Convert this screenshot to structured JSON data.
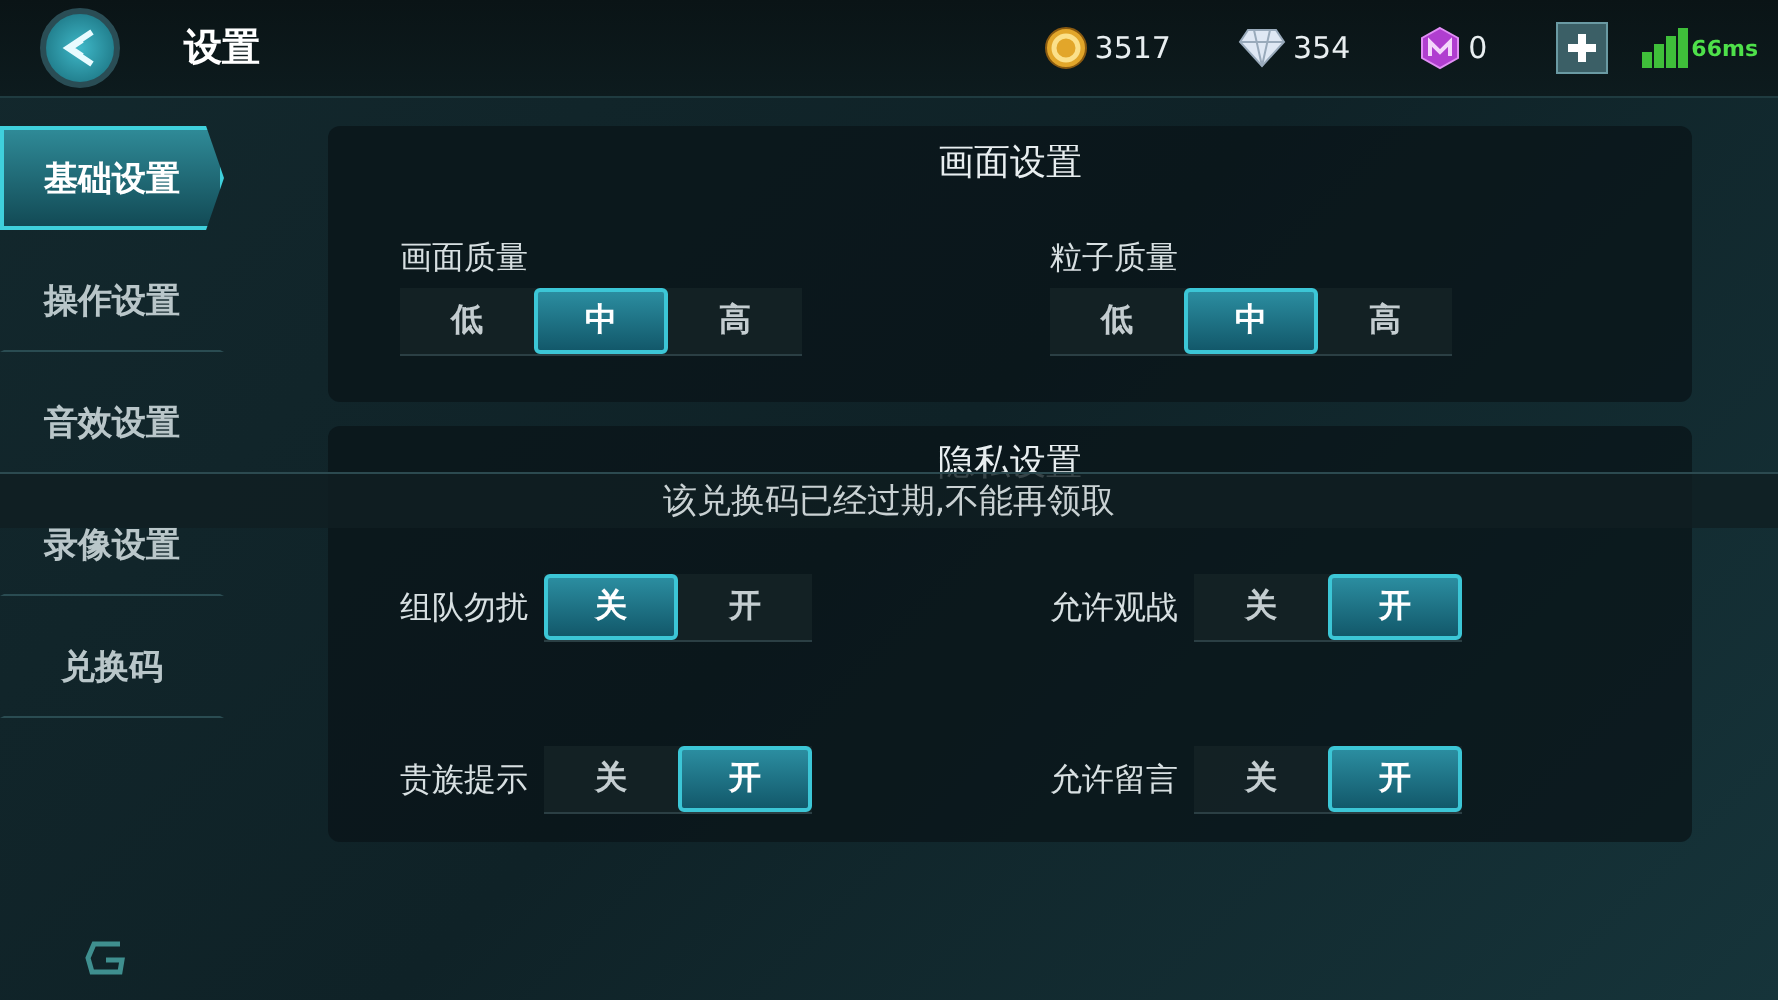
{
  "header": {
    "title": "设置",
    "currencies": [
      {
        "kind": "gold",
        "amount": "3517"
      },
      {
        "kind": "diamond",
        "amount": "354"
      },
      {
        "kind": "gem",
        "amount": "0"
      }
    ],
    "ping": "66ms"
  },
  "sidebar": {
    "items": [
      {
        "label": "基础设置",
        "selected": true
      },
      {
        "label": "操作设置",
        "selected": false
      },
      {
        "label": "音效设置",
        "selected": false
      },
      {
        "label": "录像设置",
        "selected": false
      },
      {
        "label": "兑换码",
        "selected": false
      }
    ]
  },
  "sections": [
    {
      "title": "画面设置",
      "kind": "stacked",
      "settings": [
        {
          "label": "画面质量",
          "options": [
            {
              "label": "低",
              "selected": false
            },
            {
              "label": "中",
              "selected": true
            },
            {
              "label": "高",
              "selected": false
            }
          ]
        },
        {
          "label": "粒子质量",
          "options": [
            {
              "label": "低",
              "selected": false
            },
            {
              "label": "中",
              "selected": true
            },
            {
              "label": "高",
              "selected": false
            }
          ]
        }
      ]
    },
    {
      "title": "隐私设置",
      "kind": "inline",
      "settings": [
        {
          "label": "组队勿扰",
          "options": [
            {
              "label": "关",
              "selected": true
            },
            {
              "label": "开",
              "selected": false
            }
          ]
        },
        {
          "label": "允许观战",
          "options": [
            {
              "label": "关",
              "selected": false
            },
            {
              "label": "开",
              "selected": true
            }
          ]
        },
        {
          "label": "贵族提示",
          "options": [
            {
              "label": "关",
              "selected": false
            },
            {
              "label": "开",
              "selected": true
            }
          ]
        },
        {
          "label": "允许留言",
          "options": [
            {
              "label": "关",
              "selected": false
            },
            {
              "label": "开",
              "selected": true
            }
          ]
        }
      ]
    }
  ],
  "toast": "该兑换码已经过期,不能再领取"
}
